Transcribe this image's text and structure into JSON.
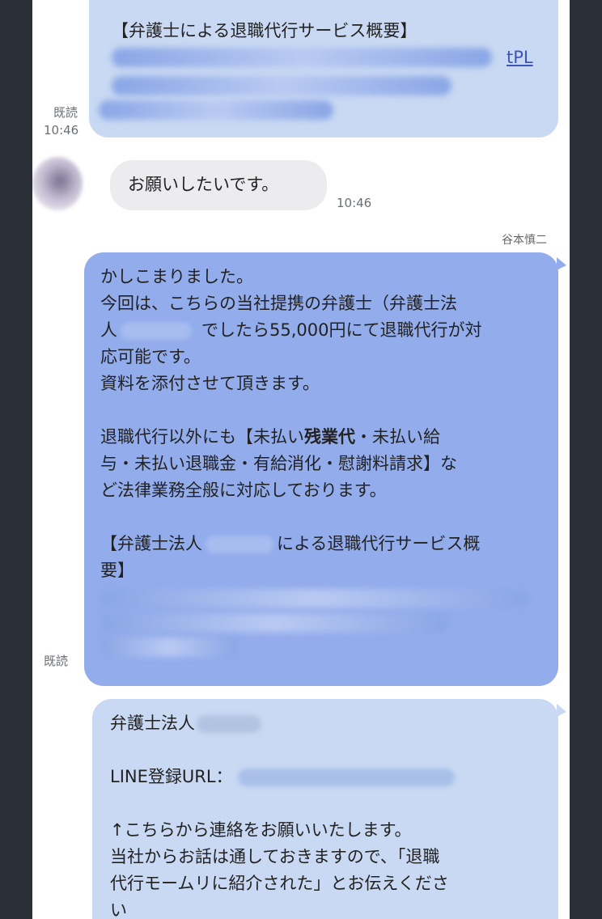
{
  "messages": {
    "first": {
      "header": "【弁護士による退職代行サービス概要】",
      "link_tail": "tPL",
      "read_label": "既読",
      "time": "10:46"
    },
    "incoming": {
      "text": "お願いしたいです。",
      "time": "10:46"
    },
    "reply": {
      "sender": "谷本慎二",
      "line1": "かしこまりました。",
      "line2": "今回は、こちらの当社提携の弁護士（弁護士法",
      "line3_pre": "人",
      "line3_post": "でしたら55,000円にて退職代行が対",
      "line4": "応可能です。",
      "line5": "資料を添付させて頂きます。",
      "line6_pre": "退職代行以外にも【未払い",
      "line6_bold": "残業代",
      "line6_post": "・未払い給",
      "line7": "与・未払い退職金・有給消化・慰謝料請求】な",
      "line8": "ど法律業務全般に対応しております。",
      "line9_pre": "【弁護士法人",
      "line9_post": "による退職代行サービス概",
      "line10": "要】",
      "read_label": "既読"
    },
    "last": {
      "line1_pre": "弁護士法人",
      "line2": "LINE登録URL：",
      "line3": "↑こちらから連絡をお願いいたします。",
      "line4": "当社からお話は通しておきますので、「退職",
      "line5": "代行モームリに紹介された」とお伝えくださ",
      "line6": "い"
    }
  }
}
